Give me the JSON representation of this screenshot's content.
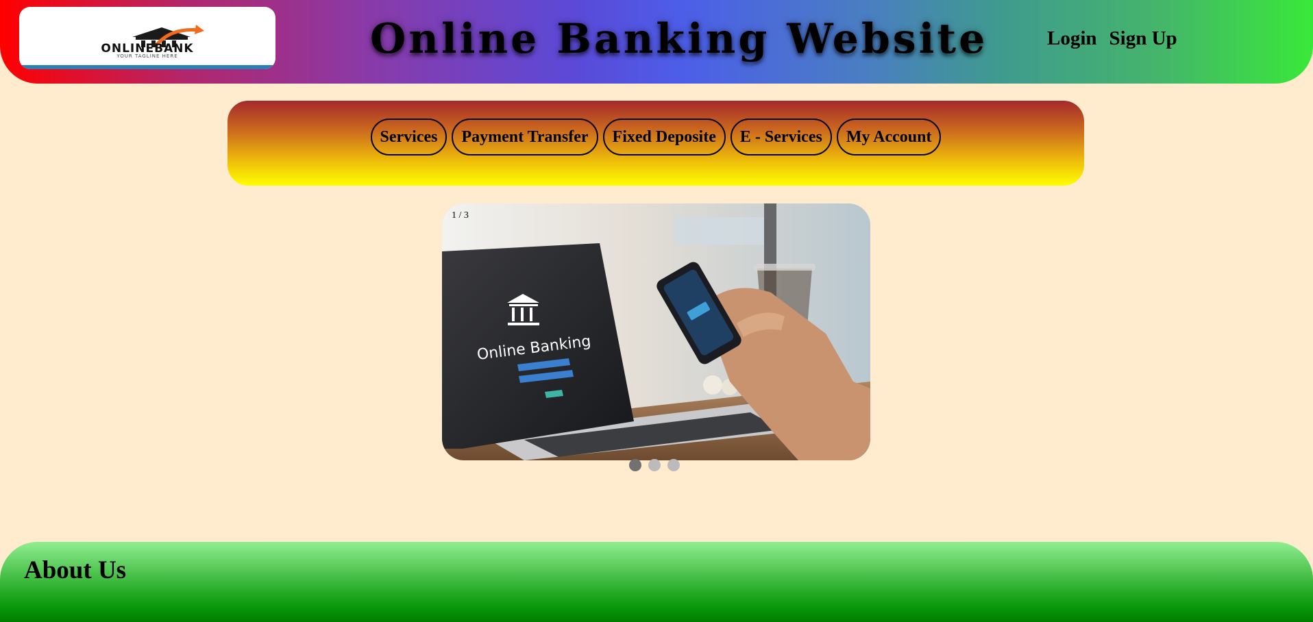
{
  "header": {
    "logo": {
      "wordmark": "ONLINEBANK",
      "tagline": "YOUR TAGLINE HERE",
      "icon": "bank-building-icon"
    },
    "title": "Online Banking Website",
    "auth": {
      "login_label": "Login",
      "signup_label": "Sign Up"
    }
  },
  "nav": {
    "items": [
      {
        "label": "Services"
      },
      {
        "label": "Payment Transfer"
      },
      {
        "label": "Fixed Deposite"
      },
      {
        "label": "E - Services"
      },
      {
        "label": "My Account"
      }
    ]
  },
  "slideshow": {
    "counter": "1 / 3",
    "current_slide": 1,
    "total_slides": 3,
    "image_caption": "Online Banking"
  },
  "about": {
    "title": "About Us"
  },
  "colors": {
    "page_background": "#ffebcd",
    "dot_active": "#717171",
    "dot_inactive": "#bbbbbb"
  }
}
